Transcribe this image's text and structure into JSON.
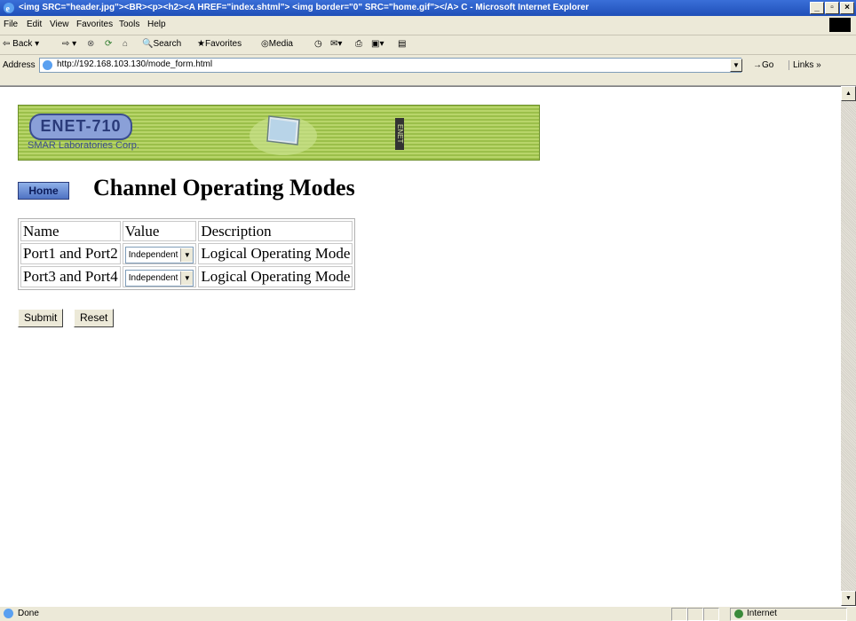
{
  "window": {
    "title": "<img SRC=\"header.jpg\"><BR><p><h2><A HREF=\"index.shtml\"> <img border=\"0\" SRC=\"home.gif\"></A>  C - Microsoft Internet Explorer"
  },
  "menu": [
    "File",
    "Edit",
    "View",
    "Favorites",
    "Tools",
    "Help"
  ],
  "toolbar": {
    "back": "Back",
    "search": "Search",
    "favorites": "Favorites",
    "media": "Media"
  },
  "address": {
    "label": "Address",
    "url": "http://192.168.103.130/mode_form.html",
    "go": "Go",
    "links": "Links"
  },
  "banner": {
    "logo": "ENET-710",
    "company": "SMAR Laboratories Corp.",
    "vertical": "ENET"
  },
  "page": {
    "home": "Home",
    "title": "Channel Operating Modes"
  },
  "table": {
    "headers": [
      "Name",
      "Value",
      "Description"
    ],
    "rows": [
      {
        "name": "Port1 and Port2",
        "value": "Independent",
        "description": "Logical Operating Mode"
      },
      {
        "name": "Port3 and Port4",
        "value": "Independent",
        "description": "Logical Operating Mode"
      }
    ]
  },
  "buttons": {
    "submit": "Submit",
    "reset": "Reset"
  },
  "status": {
    "text": "Done",
    "zone": "Internet"
  },
  "colors": {
    "titlebar": "#1f4fb8",
    "banner": "#9bbf4a",
    "home_button": "#4f73c4"
  }
}
